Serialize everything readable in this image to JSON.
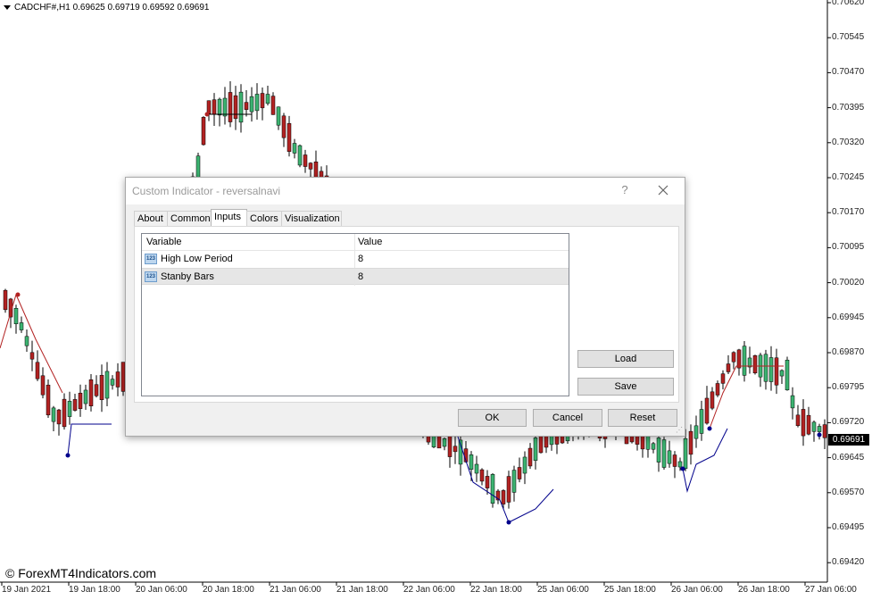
{
  "chart": {
    "symbol_line": "CADCHF#,H1  0.69625 0.69719 0.69592 0.69691",
    "watermark": "© ForexMT4Indicators.com",
    "current_price": "0.69691",
    "price_axis": [
      "0.70620",
      "0.70545",
      "0.70470",
      "0.70395",
      "0.70320",
      "0.70245",
      "0.70170",
      "0.70095",
      "0.70020",
      "0.69945",
      "0.69870",
      "0.69795",
      "0.69720",
      "0.69645",
      "0.69570",
      "0.69495",
      "0.69420"
    ],
    "time_axis": [
      "19 Jan 2021",
      "19 Jan 18:00",
      "20 Jan 06:00",
      "20 Jan 18:00",
      "21 Jan 06:00",
      "21 Jan 18:00",
      "22 Jan 06:00",
      "22 Jan 18:00",
      "25 Jan 06:00",
      "25 Jan 18:00",
      "26 Jan 06:00",
      "26 Jan 18:00",
      "27 Jan 06:00"
    ],
    "colors": {
      "bull": "#3cb371",
      "bear": "#b22222",
      "support_line": "#00008b",
      "resistance_line": "#b22222"
    }
  },
  "dialog": {
    "title": "Custom Indicator - reversalnavi",
    "help_label": "?",
    "tabs": [
      "About",
      "Common",
      "Inputs",
      "Colors",
      "Visualization"
    ],
    "active_tab": "Inputs",
    "columns": {
      "variable": "Variable",
      "value": "Value"
    },
    "rows": [
      {
        "icon": "123",
        "name": "High Low Period",
        "value": "8"
      },
      {
        "icon": "123",
        "name": "Stanby Bars",
        "value": "8"
      }
    ],
    "buttons": {
      "load": "Load",
      "save": "Save",
      "ok": "OK",
      "cancel": "Cancel",
      "reset": "Reset"
    }
  }
}
